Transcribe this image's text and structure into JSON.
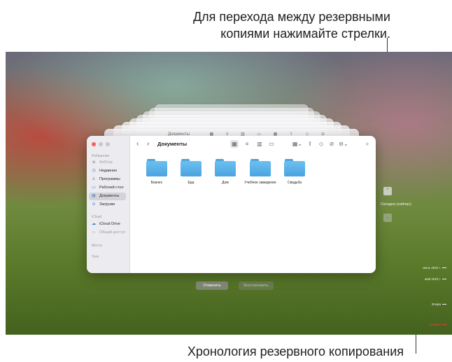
{
  "callouts": {
    "top_line1": "Для перехода между резервными",
    "top_line2": "копиями нажимайте стрелки.",
    "bottom": "Хронология резервного копирования"
  },
  "finder": {
    "title": "Документы",
    "sidebar": {
      "favorites_header": "Избранное",
      "items": [
        {
          "label": "AirDrop",
          "icon": "airdrop-icon",
          "glyph": "◉"
        },
        {
          "label": "Недавние",
          "icon": "clock-icon",
          "glyph": "◷"
        },
        {
          "label": "Программы",
          "icon": "applications-icon",
          "glyph": "⅄"
        },
        {
          "label": "Рабочий стол",
          "icon": "desktop-icon",
          "glyph": "▭"
        },
        {
          "label": "Документы",
          "icon": "document-icon",
          "glyph": "▤"
        },
        {
          "label": "Загрузки",
          "icon": "download-icon",
          "glyph": "⊙"
        }
      ],
      "icloud_header": "iCloud",
      "icloud_items": [
        {
          "label": "iCloud Drive",
          "icon": "cloud-icon",
          "glyph": "☁"
        },
        {
          "label": "Общий доступ",
          "icon": "shared-folder-icon",
          "glyph": "▭"
        }
      ],
      "places_header": "Места",
      "tags_header": "Теги"
    },
    "folders": [
      "Бизнес",
      "Еда",
      "Дом",
      "Учебное заведение",
      "Свадьба"
    ]
  },
  "ghost_title": "Документы",
  "actions": {
    "cancel": "Отменить",
    "restore": "Восстановить"
  },
  "navigation": {
    "up_glyph": "⌃",
    "down_glyph": "⌄",
    "current_label": "Сегодня (сейчас)"
  },
  "timeline": [
    {
      "label": "июнь 2022 г."
    },
    {
      "label": "май 2023 г."
    },
    {
      "label": "Вчера"
    },
    {
      "label": "Сегодня"
    }
  ],
  "colors": {
    "accent": "#3a7bd5",
    "folder": "#4aa4e0",
    "timeline_current": "#ff3b30",
    "traffic_close": "#ff5f57",
    "traffic_min": "#c7c7cc",
    "traffic_max": "#c7c7cc"
  }
}
